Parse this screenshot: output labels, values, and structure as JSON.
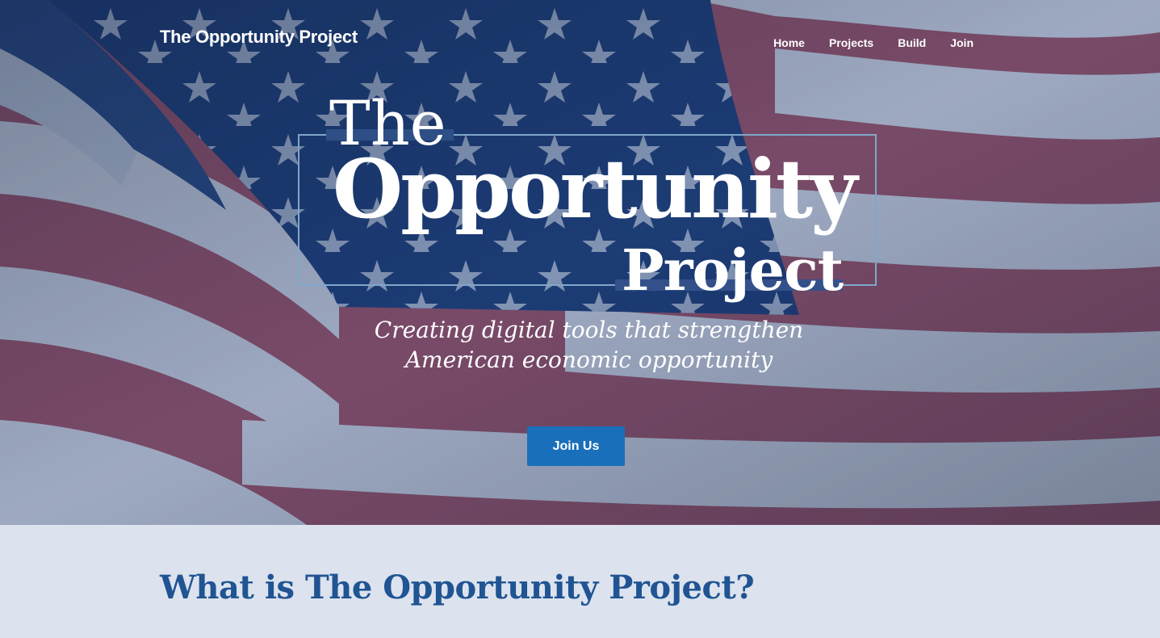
{
  "header": {
    "logo": "The Opportunity Project"
  },
  "nav": {
    "items": [
      {
        "label": "Home"
      },
      {
        "label": "Projects"
      },
      {
        "label": "Build"
      },
      {
        "label": "Join"
      }
    ]
  },
  "hero": {
    "title_line1": "The",
    "title_line2": "Opportunity",
    "title_line3": "Project",
    "tagline_line1": "Creating digital tools that strengthen",
    "tagline_line2": "American economic opportunity",
    "cta_label": "Join Us"
  },
  "about": {
    "heading": "What is The Opportunity Project?"
  },
  "colors": {
    "accent_blue": "#205493",
    "button_blue": "#1a6fba",
    "section_bg": "#dce3ee",
    "frame_line": "#7fa7c9"
  },
  "background": {
    "image": "american-flag-photo"
  }
}
